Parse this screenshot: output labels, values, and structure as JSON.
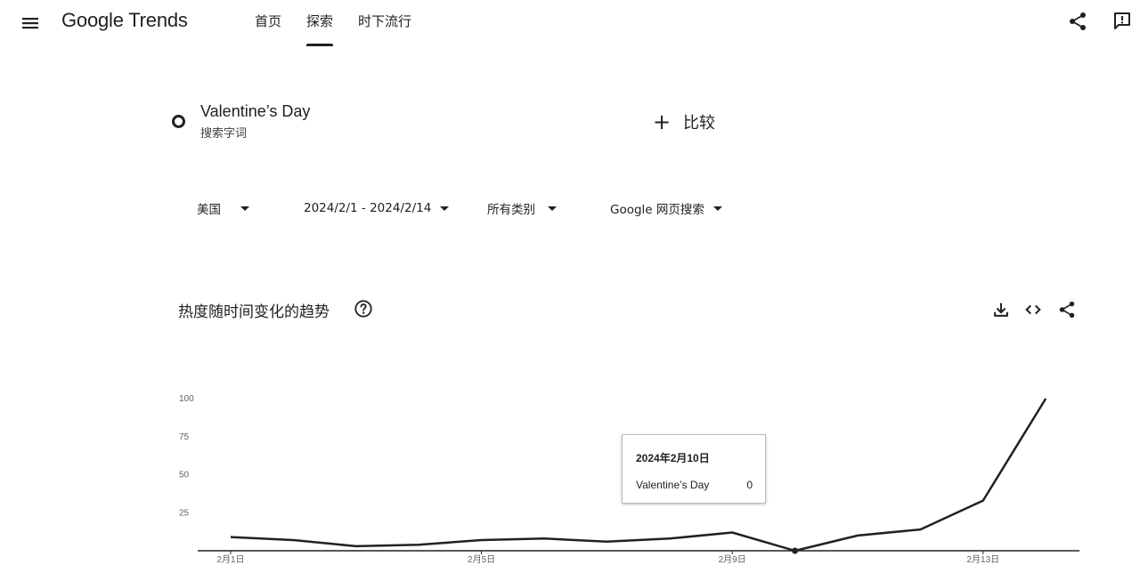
{
  "header": {
    "logo": "Google Trends",
    "nav": [
      {
        "label": "首页",
        "active": false
      },
      {
        "label": "探索",
        "active": true
      },
      {
        "label": "时下流行",
        "active": false
      }
    ],
    "icons": [
      "menu-icon",
      "share-icon",
      "feedback-icon"
    ]
  },
  "search_term": {
    "name": "Valentine’s Day",
    "type": "搜索字词"
  },
  "compare": {
    "plus": "+",
    "label": "比较"
  },
  "filters": [
    {
      "value": "美国"
    },
    {
      "value": "2024/2/1 - 2024/2/14"
    },
    {
      "value": "所有类别"
    },
    {
      "value": "Google 网页搜索"
    }
  ],
  "section": {
    "title": "热度随时间变化的趋势",
    "icons": [
      "help-icon",
      "download-icon",
      "embed-icon",
      "share-icon"
    ]
  },
  "tooltip": {
    "date": "2024年2月10日",
    "series": "Valentine’s Day",
    "value": "0"
  },
  "chart_data": {
    "type": "line",
    "x": [
      "2月1日",
      "2月2日",
      "2月3日",
      "2月4日",
      "2月5日",
      "2月6日",
      "2月7日",
      "2月8日",
      "2月9日",
      "2月10日",
      "2月11日",
      "2月12日",
      "2月13日",
      "2月14日"
    ],
    "series": [
      {
        "name": "Valentine’s Day",
        "values": [
          9,
          7,
          3,
          4,
          7,
          8,
          6,
          8,
          12,
          0,
          10,
          14,
          33,
          100
        ]
      }
    ],
    "x_tick_labels": [
      "2月1日",
      "2月5日",
      "2月9日",
      "2月13日"
    ],
    "y_ticks": [
      25,
      50,
      75,
      100
    ],
    "ylim": [
      0,
      100
    ],
    "line_color": "#202124",
    "highlighted_point": "2月10日"
  }
}
